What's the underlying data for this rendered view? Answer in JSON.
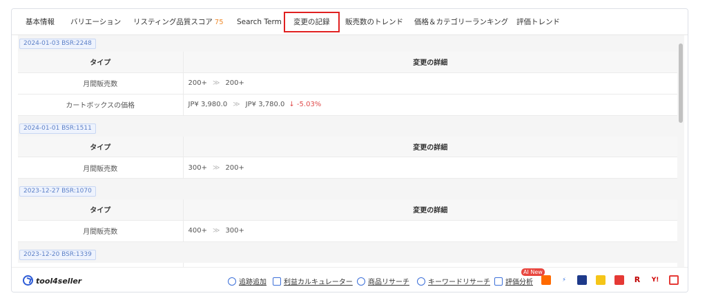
{
  "tabs": [
    {
      "label": "基本情報"
    },
    {
      "label": "バリエーション"
    },
    {
      "label": "リスティング品質スコア",
      "badge": "75"
    },
    {
      "label": "Search Term"
    },
    {
      "label": "変更の記録",
      "active": true
    },
    {
      "label": "販売数のトレンド"
    },
    {
      "label": "価格＆カテゴリーランキング"
    },
    {
      "label": "評価トレンド"
    }
  ],
  "columns": {
    "type": "タイプ",
    "detail": "変更の詳細"
  },
  "groups": [
    {
      "date": "2024-01-03 BSR:2248",
      "rows": [
        {
          "type": "月間販売数",
          "from": "200+",
          "to": "200+",
          "change": ""
        },
        {
          "type": "カートボックスの価格",
          "from": "JP¥ 3,980.0",
          "to": "JP¥ 3,780.0",
          "change": "↓ -5.03%"
        }
      ]
    },
    {
      "date": "2024-01-01 BSR:1511",
      "rows": [
        {
          "type": "月間販売数",
          "from": "300+",
          "to": "200+",
          "change": ""
        }
      ]
    },
    {
      "date": "2023-12-27 BSR:1070",
      "rows": [
        {
          "type": "月間販売数",
          "from": "400+",
          "to": "300+",
          "change": ""
        }
      ]
    },
    {
      "date": "2023-12-20 BSR:1339",
      "rows": []
    }
  ],
  "footer": {
    "logo": "tool4seller",
    "tools": [
      {
        "label": "追跡追加",
        "icon": "bell-plus-icon"
      },
      {
        "label": "利益カルキュレーター",
        "icon": "calculator-icon"
      },
      {
        "label": "商品リサーチ",
        "icon": "target-icon"
      },
      {
        "label": "キーワードリサーチ",
        "icon": "keyword-icon"
      },
      {
        "label": "評価分析",
        "icon": "review-icon"
      }
    ],
    "ai_badge": "AI New",
    "apps": [
      {
        "name": "alibaba-app-icon",
        "color": "#ff6a00",
        "text": ""
      },
      {
        "name": "lightning-app-icon",
        "color": "#ffffff",
        "text": "⚡"
      },
      {
        "name": "rakuten-search-app-icon",
        "color": "#1e3a8a",
        "text": ""
      },
      {
        "name": "yellow-app-icon",
        "color": "#f5c518",
        "text": ""
      },
      {
        "name": "red-app-icon",
        "color": "#e53935",
        "text": ""
      },
      {
        "name": "rakuten-r-app-icon",
        "color": "#ffffff",
        "text": "R"
      },
      {
        "name": "yahoo-app-icon",
        "color": "#ffffff",
        "text": "Y!"
      },
      {
        "name": "gift-app-icon",
        "color": "#ffffff",
        "text": ""
      }
    ]
  }
}
